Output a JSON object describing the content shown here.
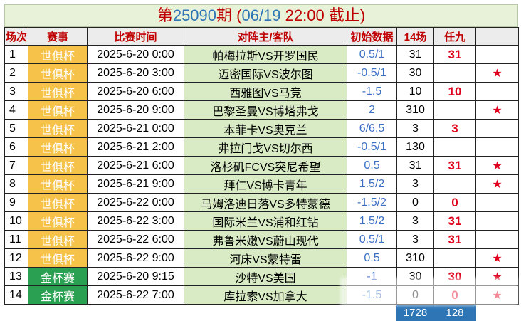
{
  "title": {
    "first": "第",
    "number": "25090",
    "middle": "期 (",
    "date": "06/19",
    "space": " ",
    "time": "22:00",
    "suffix": " 截止)"
  },
  "headers": [
    "场次",
    "赛事",
    "比赛时间",
    "对阵主/客队",
    "初始数据",
    "14场",
    "任九",
    ""
  ],
  "rows": [
    {
      "num": "1",
      "league": "世俱杯",
      "time": "2025-6-20 0:00",
      "match": "帕梅拉斯VS开罗国民",
      "odds": "0.5/1",
      "p14": "31",
      "r9": "31",
      "star": ""
    },
    {
      "num": "2",
      "league": "世俱杯",
      "time": "2025-6-20 3:00",
      "match": "迈密国际VS波尔图",
      "odds": "-0.5/1",
      "p14": "30",
      "r9": "",
      "star": "★"
    },
    {
      "num": "3",
      "league": "世俱杯",
      "time": "2025-6-20 6:00",
      "match": "西雅图VS马竞",
      "odds": "-1.5",
      "p14": "10",
      "r9": "10",
      "star": ""
    },
    {
      "num": "4",
      "league": "世俱杯",
      "time": "2025-6-20 9:00",
      "match": "巴黎圣曼VS博塔弗戈",
      "odds": "2",
      "p14": "310",
      "r9": "",
      "star": "★"
    },
    {
      "num": "5",
      "league": "世俱杯",
      "time": "2025-6-21 0:00",
      "match": "本菲卡VS奥克兰",
      "odds": "6/6.5",
      "p14": "3",
      "r9": "3",
      "star": ""
    },
    {
      "num": "6",
      "league": "世俱杯",
      "time": "2025-6-21 2:00",
      "match": "弗拉门戈VS切尔西",
      "odds": "-0.5/1",
      "p14": "130",
      "r9": "",
      "star": ""
    },
    {
      "num": "7",
      "league": "世俱杯",
      "time": "2025-6-21 6:00",
      "match": "洛杉矶FCVS突尼希望",
      "odds": "0.5",
      "p14": "31",
      "r9": "31",
      "star": "★"
    },
    {
      "num": "8",
      "league": "世俱杯",
      "time": "2025-6-21 9:00",
      "match": "拜仁VS博卡青年",
      "odds": "1.5/2",
      "p14": "3",
      "r9": "",
      "star": "★"
    },
    {
      "num": "9",
      "league": "世俱杯",
      "time": "2025-6-22 0:00",
      "match": "马姆洛迪日落VS多特蒙德",
      "odds": "-1.5/2",
      "p14": "0",
      "r9": "0",
      "star": ""
    },
    {
      "num": "10",
      "league": "世俱杯",
      "time": "2025-6-22 3:00",
      "match": "国际米兰VS浦和红钻",
      "odds": "1.5/2",
      "p14": "3",
      "r9": "31",
      "star": ""
    },
    {
      "num": "11",
      "league": "世俱杯",
      "time": "2025-6-22 6:00",
      "match": "弗鲁米嫩VS蔚山现代",
      "odds": "0.5/1",
      "p14": "3",
      "r9": "31",
      "star": ""
    },
    {
      "num": "12",
      "league": "世俱杯",
      "time": "2025-6-22 9:00",
      "match": "河床VS蒙特雷",
      "odds": "0.5",
      "p14": "310",
      "r9": "",
      "star": "★"
    },
    {
      "num": "13",
      "league": "金杯赛",
      "time": "2025-6-20 9:15",
      "match": "沙特VS美国",
      "odds": "-1",
      "p14": "30",
      "r9": "30",
      "star": "★"
    },
    {
      "num": "14",
      "league": "金杯赛",
      "time": "2025-6-22 7:00",
      "match": "库拉索VS加拿大",
      "odds": "-1.5",
      "p14": "0",
      "r9": "0",
      "star": "★"
    }
  ],
  "totals": {
    "p14": "1728",
    "r9": "128"
  }
}
